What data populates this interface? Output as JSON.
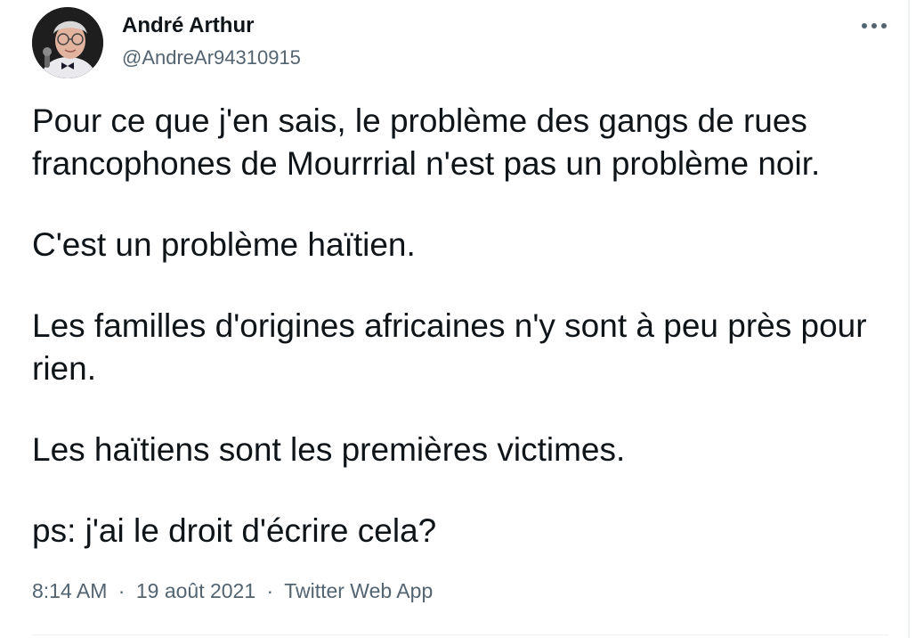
{
  "author": {
    "name": "André Arthur",
    "handle": "@AndreAr94310915",
    "avatar_icon": "profile-photo"
  },
  "more_icon": "more-horizontal-icon",
  "tweet": {
    "paragraphs": [
      "Pour ce que j'en sais, le problème des gangs de rues francophones de Mourrrial n'est pas un problème noir.",
      "C'est un problème haïtien.",
      "Les familles d'origines africaines n'y sont à peu près pour rien.",
      "Les haïtiens sont les premières victimes.",
      "ps: j'ai le droit d'écrire cela?"
    ]
  },
  "meta": {
    "time": "8:14 AM",
    "separator": "·",
    "date": "19 août 2021",
    "source": "Twitter Web App"
  },
  "colors": {
    "text": "#0f1419",
    "secondary": "#536471",
    "border": "#eff3f4"
  }
}
